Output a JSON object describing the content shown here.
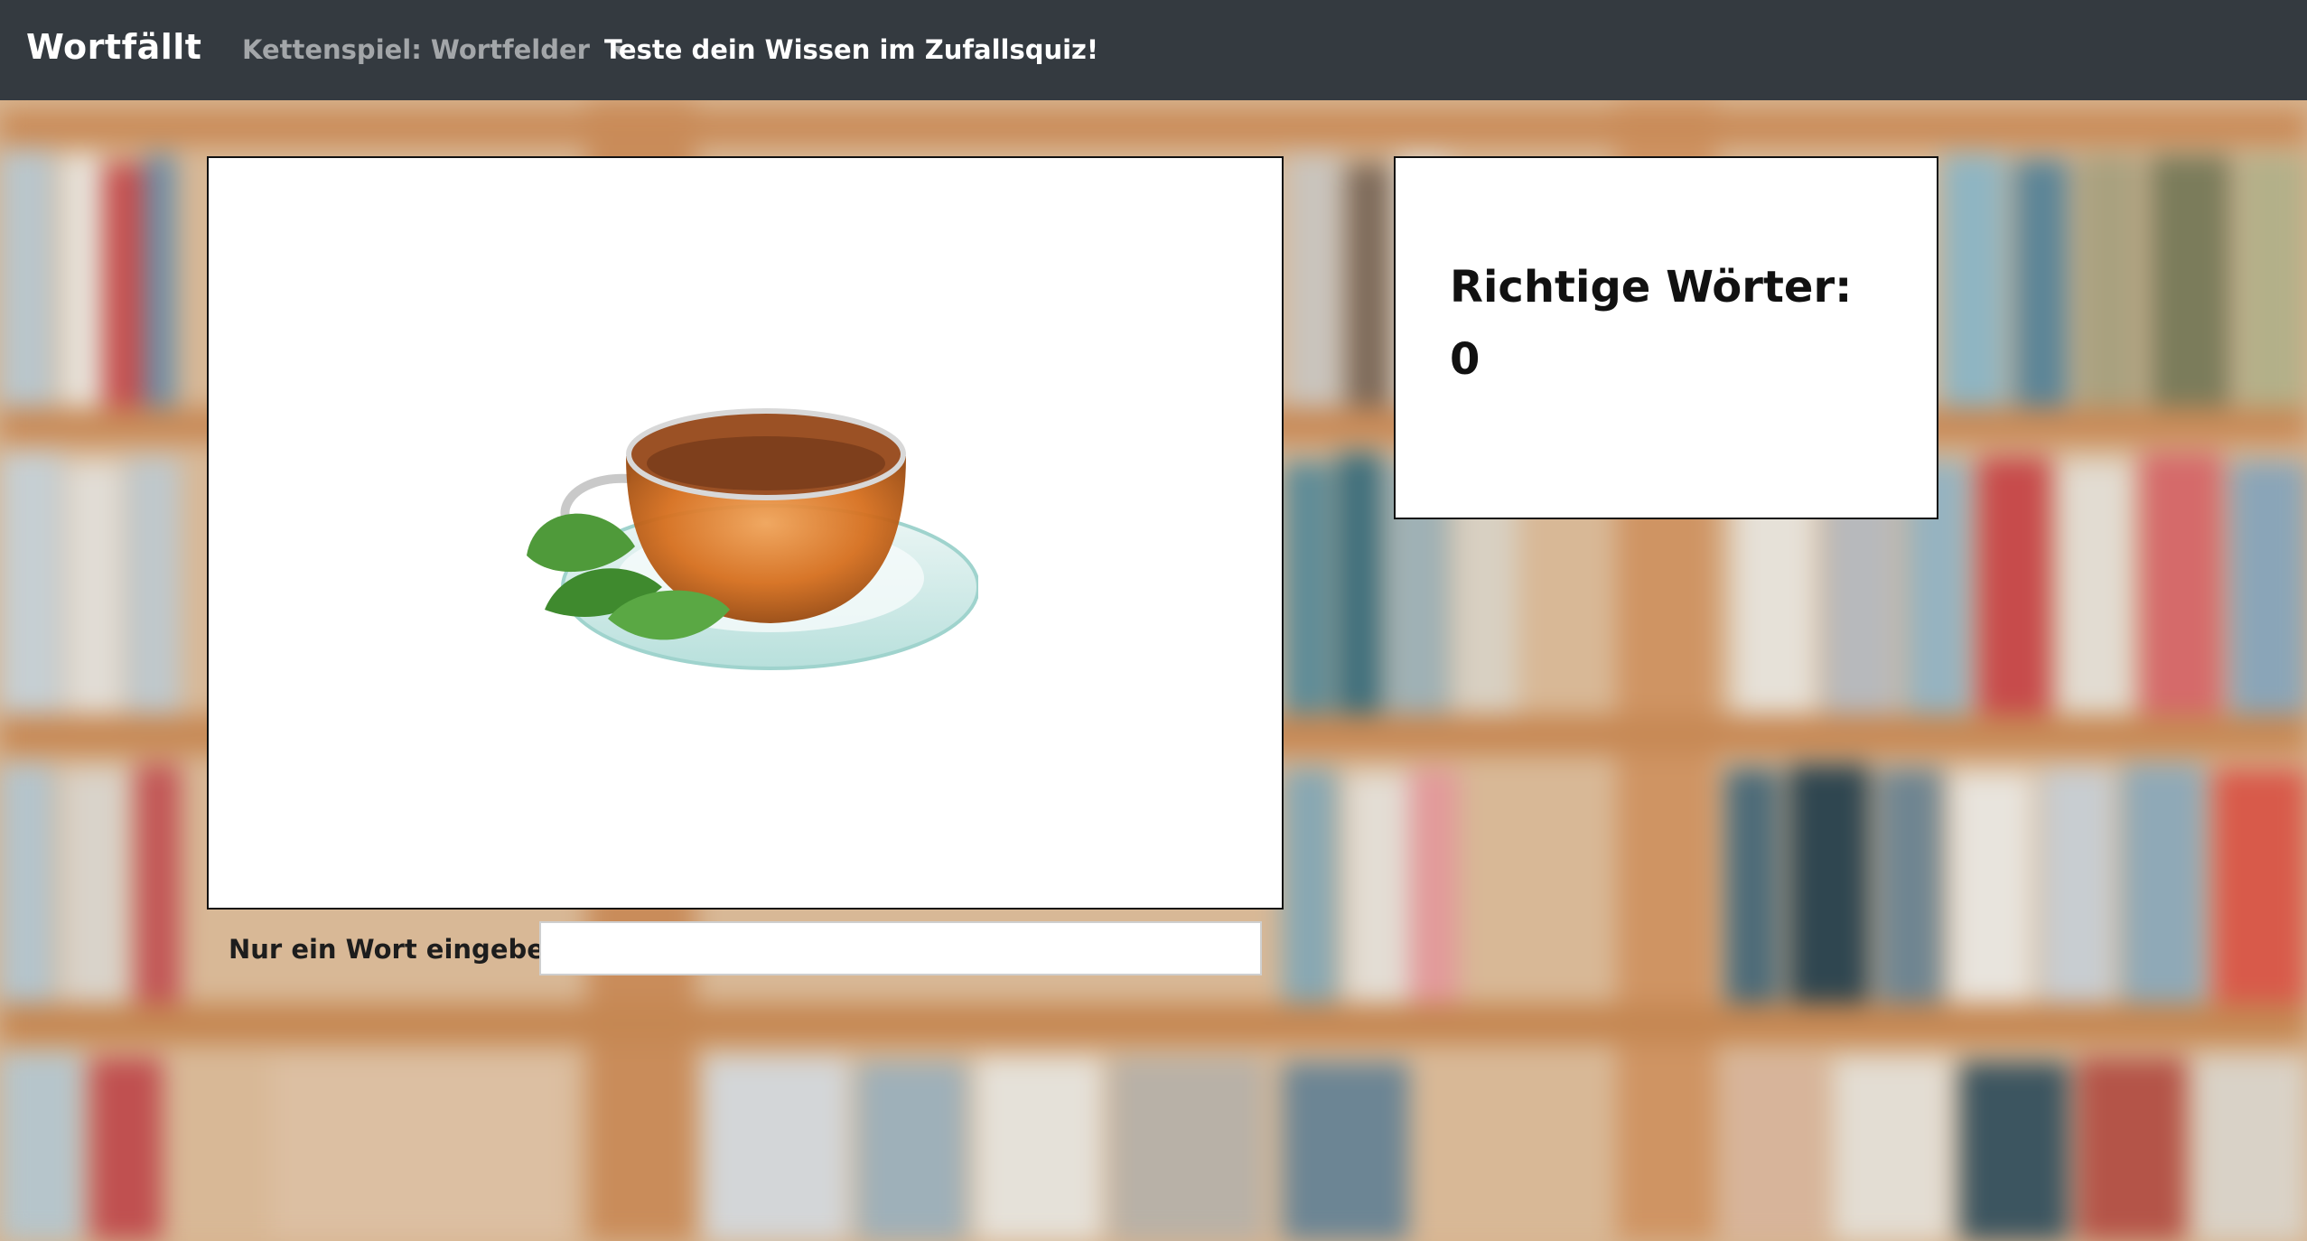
{
  "navbar": {
    "brand": "Wortfällt",
    "dropdown_label": "Kettenspiel: Wortfelder",
    "quiz_link": "Teste dein Wissen im Zufallsquiz!"
  },
  "main": {
    "image_alt": "tea-cup-image",
    "score_label": "Richtige Wörter:",
    "score_value": "0",
    "input_label": "Nur ein Wort eingeben:",
    "input_value": "",
    "input_placeholder": ""
  },
  "colors": {
    "navbar_bg": "#343a40",
    "navbar_text": "#ffffff",
    "navbar_muted": "rgba(255,255,255,0.55)",
    "panel_bg": "#ffffff",
    "panel_border": "#111111"
  }
}
